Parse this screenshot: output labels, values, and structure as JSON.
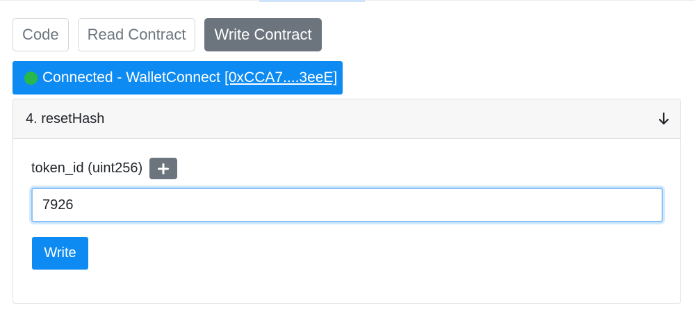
{
  "tabs": [
    {
      "label": "Code",
      "active": false
    },
    {
      "label": "Read Contract",
      "active": false
    },
    {
      "label": "Write Contract",
      "active": true
    }
  ],
  "connection": {
    "status_text": "Connected - WalletConnect",
    "address": "[0xCCA7....3eeE]",
    "status_color": "#28b94a"
  },
  "method": {
    "title": "4. resetHash",
    "expand_icon": "arrow-down-icon",
    "param_label": "token_id (uint256)",
    "add_icon": "plus-icon",
    "input_value": "7926",
    "write_label": "Write"
  },
  "colors": {
    "primary": "#0d8bf2",
    "secondary": "#6c757d"
  }
}
